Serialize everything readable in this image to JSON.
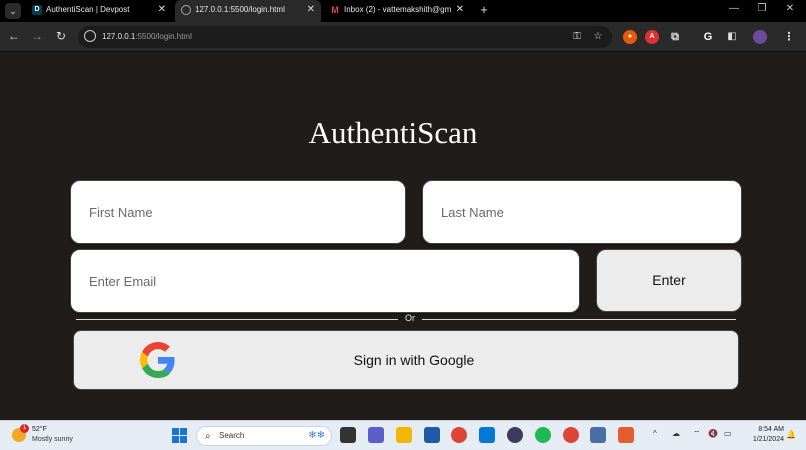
{
  "browser": {
    "tabs": [
      {
        "title": "AuthentiScan | Devpost",
        "favicon": "D",
        "favicon_color": "#003e54",
        "active": false
      },
      {
        "title": "127.0.0.1:5500/login.html",
        "favicon": "globe-icon",
        "active": true
      },
      {
        "title": "Inbox (2) - vattemakshith@gm",
        "favicon": "gmail-icon",
        "active": false
      }
    ],
    "new_tab_label": "+",
    "close_label": "✕",
    "url_host": "127.0.0.1",
    "url_path": ":5500/login.html",
    "window_controls": [
      "—",
      "❐",
      "✕"
    ]
  },
  "page": {
    "title": "AuthentiScan",
    "first_name_placeholder": "First Name",
    "last_name_placeholder": "Last Name",
    "email_placeholder": "Enter Email",
    "enter_label": "Enter",
    "or_label": "Or",
    "google_label": "Sign in with Google"
  },
  "taskbar": {
    "weather_temp": "52°F",
    "weather_desc": "Mostly sunny",
    "weather_badge": "1",
    "search_label": "Search",
    "time": "8:54 AM",
    "date": "1/21/2024"
  },
  "colors": {
    "page_background": "#201c1a",
    "input_background": "#ffffff",
    "button_background": "#ececec",
    "taskbar_background": "#e6ecf4"
  }
}
